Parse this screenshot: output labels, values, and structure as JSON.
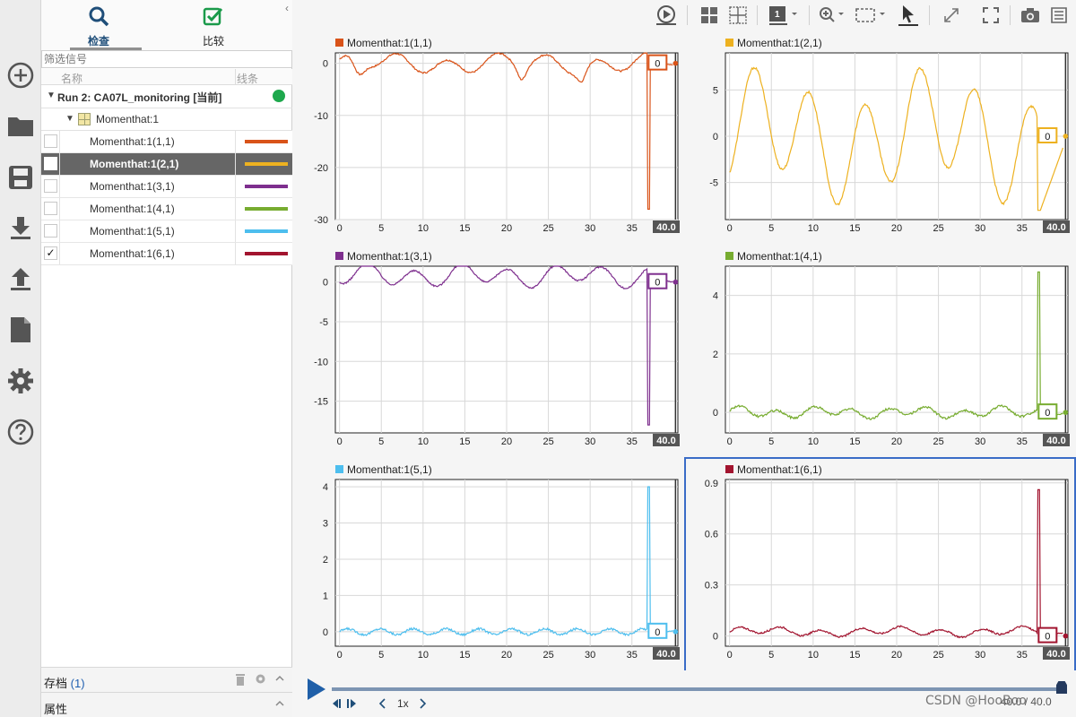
{
  "panel": {
    "tabs": [
      {
        "label": "检查",
        "icon": "magnifier-icon",
        "active": true
      },
      {
        "label": "比较",
        "icon": "checkbox-check-icon",
        "active": false
      }
    ],
    "collapse_glyph": "‹",
    "filter_placeholder": "筛选信号",
    "columns": {
      "name": "名称",
      "line": "线条"
    },
    "run": {
      "label": "Run 2: CA07L_monitoring [当前]",
      "status_color": "#1ea84d"
    },
    "group": {
      "label": "Momenthat:1"
    },
    "signals": [
      {
        "name": "Momenthat:1(1,1)",
        "color": "#d95319",
        "checked": false,
        "selected": false
      },
      {
        "name": "Momenthat:1(2,1)",
        "color": "#edb120",
        "checked": false,
        "selected": true
      },
      {
        "name": "Momenthat:1(3,1)",
        "color": "#7e2f8e",
        "checked": false,
        "selected": false
      },
      {
        "name": "Momenthat:1(4,1)",
        "color": "#77ac30",
        "checked": false,
        "selected": false
      },
      {
        "name": "Momenthat:1(5,1)",
        "color": "#4dbeee",
        "checked": false,
        "selected": false
      },
      {
        "name": "Momenthat:1(6,1)",
        "color": "#a2142f",
        "checked": true,
        "selected": false
      }
    ],
    "archive": {
      "label": "存档",
      "count": "(1)"
    },
    "properties": {
      "label": "属性"
    }
  },
  "rail_icons": [
    "add-circle-icon",
    "folder-icon",
    "save-icon",
    "download-icon",
    "upload-icon",
    "document-icon",
    "gear-icon",
    "help-icon"
  ],
  "toolbar_icons": [
    "play-record-icon",
    "layout-grid-icon",
    "layout-subplot-icon",
    "visualization-1-icon",
    "zoom-icon",
    "fit-view-icon",
    "cursor-icon",
    "expand-icon",
    "fullscreen-icon",
    "camera-icon",
    "more-icon"
  ],
  "toolbar_viz_number": "1",
  "plots": [
    {
      "title": "Momenthat:1(1,1)",
      "color": "#d95319",
      "ylim": [
        -30,
        2
      ],
      "yticks": [
        0,
        -10,
        -20,
        -30
      ],
      "value_box": "0",
      "end_label": "40.0",
      "selected": false
    },
    {
      "title": "Momenthat:1(2,1)",
      "color": "#edb120",
      "ylim": [
        -9,
        9
      ],
      "yticks": [
        5,
        0,
        -5
      ],
      "value_box": "0",
      "end_label": "40.0",
      "selected": false
    },
    {
      "title": "Momenthat:1(3,1)",
      "color": "#7e2f8e",
      "ylim": [
        -19,
        2
      ],
      "yticks": [
        0,
        -5,
        -10,
        -15
      ],
      "value_box": "0",
      "end_label": "40.0",
      "selected": false
    },
    {
      "title": "Momenthat:1(4,1)",
      "color": "#77ac30",
      "ylim": [
        -0.7,
        5
      ],
      "yticks": [
        4,
        2,
        0
      ],
      "value_box": "0",
      "end_label": "40.0",
      "selected": false
    },
    {
      "title": "Momenthat:1(5,1)",
      "color": "#4dbeee",
      "ylim": [
        -0.4,
        4.2
      ],
      "yticks": [
        4,
        3,
        2,
        1,
        0
      ],
      "value_box": "0",
      "end_label": "40.0",
      "selected": false
    },
    {
      "title": "Momenthat:1(6,1)",
      "color": "#a2142f",
      "ylim": [
        -0.06,
        0.92
      ],
      "yticks": [
        0.9,
        0.6,
        0.3,
        0
      ],
      "value_box": "0",
      "end_label": "40.0",
      "selected": true
    }
  ],
  "xticks": [
    0,
    5,
    10,
    15,
    20,
    25,
    30,
    35
  ],
  "xlim": [
    -0.5,
    40.5
  ],
  "playback": {
    "speed": "1x",
    "time": "40.0 / 40.0"
  },
  "watermark": "CSDN @HooBoo"
}
